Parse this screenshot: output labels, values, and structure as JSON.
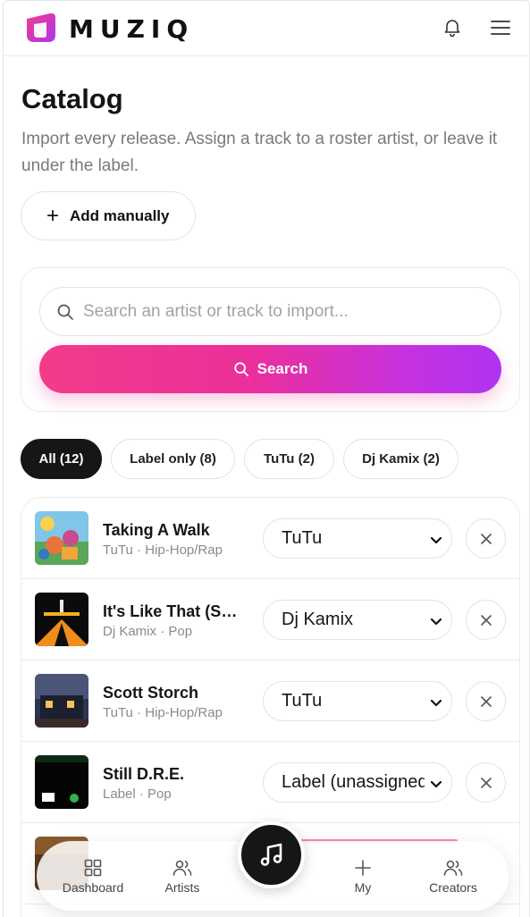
{
  "app": {
    "brand": "MUZIQ",
    "brand_gradient": [
      "#f23c8a",
      "#b133f0"
    ]
  },
  "header": {
    "notifications_icon": "bell-icon",
    "menu_icon": "hamburger-icon"
  },
  "page": {
    "title": "Catalog",
    "subtitle": "Import every release. Assign a track to a roster artist, or leave it under the label.",
    "add_manually": "Add manually"
  },
  "search": {
    "placeholder": "Search an artist or track to import...",
    "button_label": "Search"
  },
  "filters": [
    {
      "label": "All (12)",
      "active": true
    },
    {
      "label": "Label only (8)",
      "active": false
    },
    {
      "label": "TuTu (2)",
      "active": false
    },
    {
      "label": "Dj Kamix (2)",
      "active": false
    }
  ],
  "tracks": [
    {
      "title": "Taking A Walk",
      "artist": "TuTu",
      "genre": "Hip-Hop/Rap",
      "assigned": "TuTu"
    },
    {
      "title": "It's Like That (Scott Storch Remix)",
      "artist": "Dj Kamix",
      "genre": "Pop",
      "assigned": "Dj Kamix"
    },
    {
      "title": "Scott Storch",
      "artist": "TuTu",
      "genre": "Hip-Hop/Rap",
      "assigned": "TuTu"
    },
    {
      "title": "Still D.R.E.",
      "artist": "Label",
      "genre": "Pop",
      "assigned": "Label (unassigned)"
    }
  ],
  "meta_separator": "·",
  "bottom_nav": [
    {
      "label": "Dashboard",
      "icon": "grid-icon"
    },
    {
      "label": "Artists",
      "icon": "users-icon"
    },
    {
      "label": "",
      "icon": "music-note-icon"
    },
    {
      "label": "My",
      "icon": "plus-icon"
    },
    {
      "label": "Creators",
      "icon": "users-icon"
    }
  ],
  "colors": {
    "accent_pink": "#f23c8a",
    "accent_purple": "#b133f0",
    "dark": "#161616"
  }
}
